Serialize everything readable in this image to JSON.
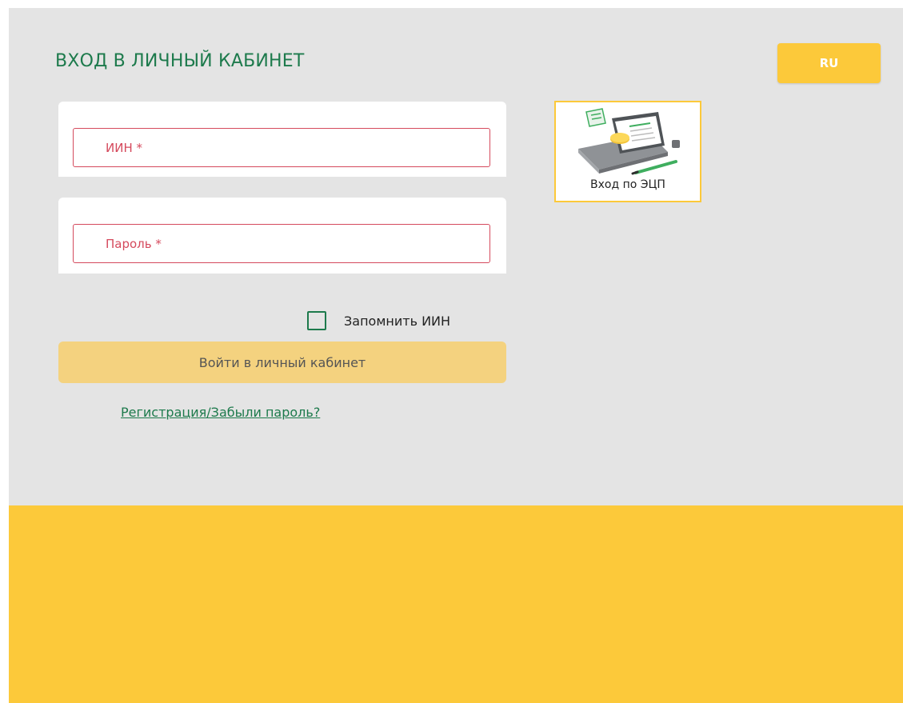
{
  "header": {
    "title": "ВХОД В ЛИЧНЫЙ КАБИНЕТ",
    "language": "RU"
  },
  "form": {
    "iin_placeholder": "ИИН *",
    "iin_value": "",
    "password_placeholder": "Пароль *",
    "password_value": "",
    "remember_label": "Запомнить ИИН",
    "remember_checked": false,
    "login_button": "Войти в личный кабинет",
    "register_link": "Регистрация/Забыли пароль?"
  },
  "ecp": {
    "label": "Вход по ЭЦП",
    "icon": "ecp-laptop-icon"
  },
  "colors": {
    "accent_green": "#1d7a4c",
    "accent_yellow": "#fcc93a",
    "error_red": "#d54a5d",
    "background": "#e4e4e4",
    "button_disabled": "#f4d27f"
  }
}
